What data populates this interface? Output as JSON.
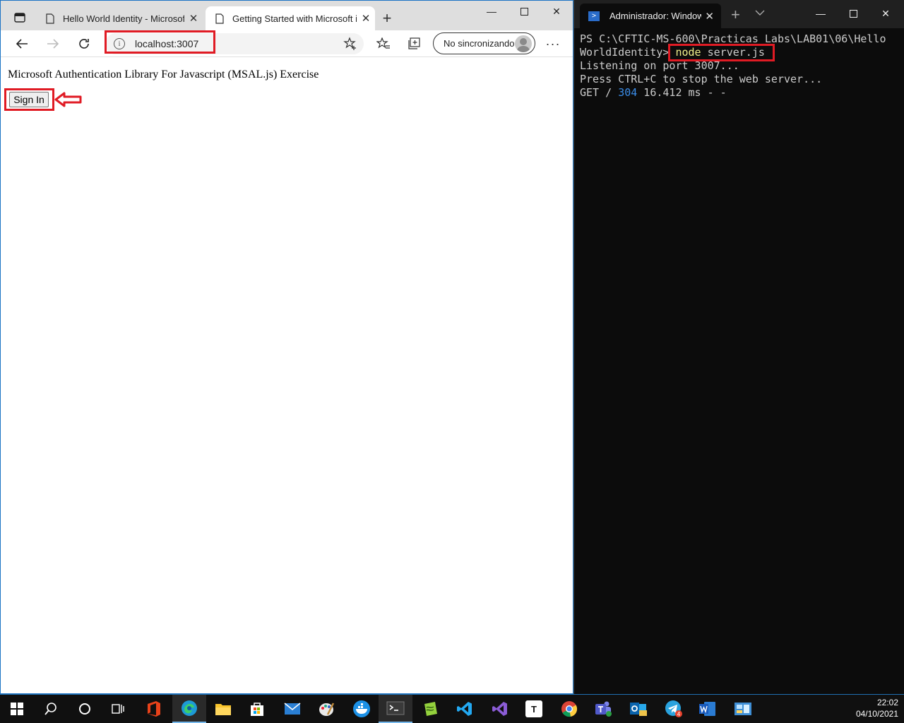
{
  "browser": {
    "tabs": [
      {
        "title": "Hello World Identity - Microsoft"
      },
      {
        "title": "Getting Started with Microsoft id"
      }
    ],
    "address": "localhost:3007",
    "sync_label": "No sincronizando",
    "page": {
      "heading": "Microsoft Authentication Library For Javascript (MSAL.js) Exercise",
      "signin_label": "Sign In"
    }
  },
  "terminal": {
    "tab_title": "Administrador: Windows PowerShell",
    "lines": {
      "l1": "PS C:\\CFTIC-MS-600\\Practicas_Labs\\LAB01\\06\\Hello",
      "l2_prompt": "WorldIdentity> ",
      "l2_cmd": "node",
      "l2_arg": " server.js",
      "l3": "Listening on port 3007...",
      "l4": "Press CTRL+C to stop the web server...",
      "l5_pre": "GET / ",
      "l5_status": "304",
      "l5_post": " 16.412 ms - -"
    }
  },
  "taskbar": {
    "time": "22:02",
    "date": "04/10/2021",
    "badge_count": "4",
    "apps": [
      "windows-start",
      "search",
      "cortana",
      "task-view",
      "office",
      "edge",
      "file-explorer",
      "store",
      "mail",
      "paint",
      "docker",
      "terminal",
      "notepad-plus",
      "vscode",
      "visual-studio",
      "typora",
      "chrome",
      "teams",
      "outlook",
      "telegram",
      "word",
      "control-panel"
    ]
  },
  "colors": {
    "annotation": "#e01b24",
    "ps_blue": "#2a6cc9",
    "accent": "#1a73c4"
  }
}
